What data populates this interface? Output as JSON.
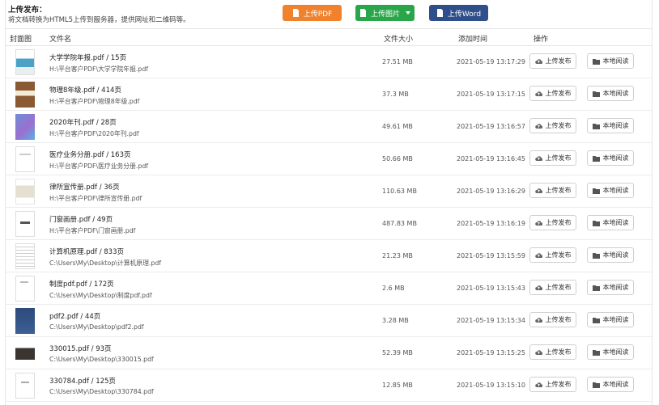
{
  "header": {
    "title": "上传发布：",
    "description": "将文档转换为HTML5上传到服务器，提供网址和二维码等。",
    "buttons": {
      "pdf": "上传PDF",
      "image": "上传图片",
      "word": "上传Word"
    }
  },
  "table": {
    "columns": {
      "cover": "封面图",
      "filename": "文件名",
      "size": "文件大小",
      "time": "添加时间",
      "actions": "操作"
    },
    "action_labels": {
      "upload": "上传发布",
      "read": "本地阅读"
    },
    "rows": [
      {
        "name": "大学学院年报.pdf / 15页",
        "path": "H:\\平台客户PDF\\大学学院年报.pdf",
        "size": "27.51 MB",
        "time": "2021-05-19 13:17:29"
      },
      {
        "name": "物理8年级.pdf / 414页",
        "path": "H:\\平台客户PDF\\物理8年级.pdf",
        "size": "37.3 MB",
        "time": "2021-05-19 13:17:15"
      },
      {
        "name": "2020年刊.pdf / 28页",
        "path": "H:\\平台客户PDF\\2020年刊.pdf",
        "size": "49.61 MB",
        "time": "2021-05-19 13:16:57"
      },
      {
        "name": "医疗业务分册.pdf / 163页",
        "path": "H:\\平台客户PDF\\医疗业务分册.pdf",
        "size": "50.66 MB",
        "time": "2021-05-19 13:16:45"
      },
      {
        "name": "律所宣传册.pdf / 36页",
        "path": "H:\\平台客户PDF\\律所宣传册.pdf",
        "size": "110.63 MB",
        "time": "2021-05-19 13:16:29"
      },
      {
        "name": "门窗画册.pdf / 49页",
        "path": "H:\\平台客户PDF\\门窗画册.pdf",
        "size": "487.83 MB",
        "time": "2021-05-19 13:16:19"
      },
      {
        "name": "计算机原理.pdf / 833页",
        "path": "C:\\Users\\My\\Desktop\\计算机原理.pdf",
        "size": "21.23 MB",
        "time": "2021-05-19 13:15:59"
      },
      {
        "name": "制度pdf.pdf / 172页",
        "path": "C:\\Users\\My\\Desktop\\制度pdf.pdf",
        "size": "2.6 MB",
        "time": "2021-05-19 13:15:43"
      },
      {
        "name": "pdf2.pdf / 44页",
        "path": "C:\\Users\\My\\Desktop\\pdf2.pdf",
        "size": "3.28 MB",
        "time": "2021-05-19 13:15:34"
      },
      {
        "name": "330015.pdf / 93页",
        "path": "C:\\Users\\My\\Desktop\\330015.pdf",
        "size": "52.39 MB",
        "time": "2021-05-19 13:15:25"
      },
      {
        "name": "330784.pdf / 125页",
        "path": "C:\\Users\\My\\Desktop\\330784.pdf",
        "size": "12.85 MB",
        "time": "2021-05-19 13:15:10"
      }
    ]
  },
  "colors": {
    "pdf_button": "#f0822d",
    "image_button": "#2aa64a",
    "word_button": "#2f4f8a"
  },
  "icons": {
    "header_button": "upload-document-icon",
    "upload_action": "cloud-upload-icon",
    "read_action": "folder-icon"
  }
}
